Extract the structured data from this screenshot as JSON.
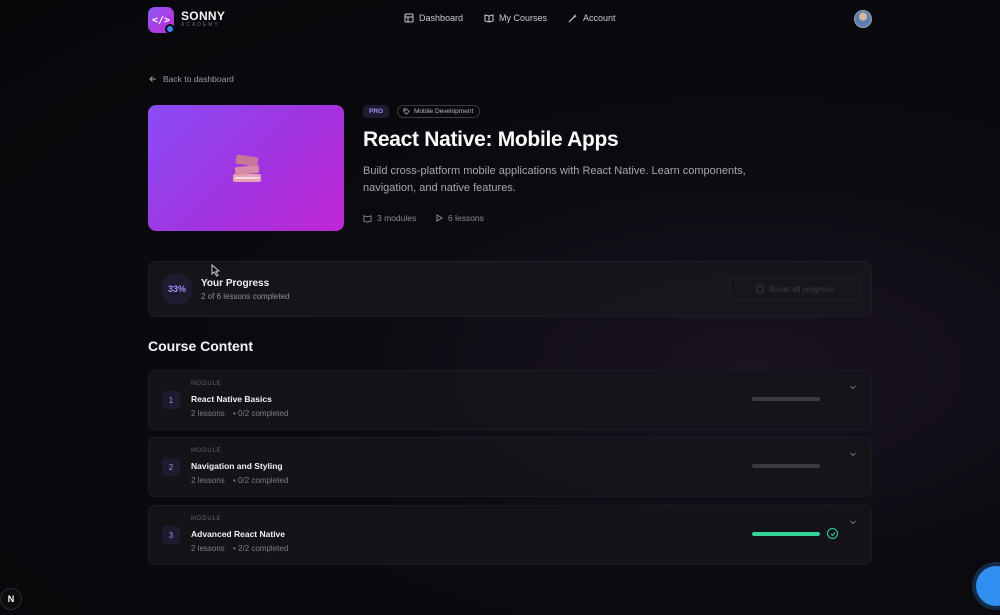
{
  "brand": {
    "name": "SONNY",
    "subtitle": "ACADEMY"
  },
  "nav": {
    "dashboard": "Dashboard",
    "my_courses": "My Courses",
    "account": "Account"
  },
  "back_label": "Back to dashboard",
  "course": {
    "tier": "PRO",
    "category": "Mobile Development",
    "title": "React Native: Mobile Apps",
    "description": "Build cross-platform mobile applications with React Native. Learn components, navigation, and native features.",
    "modules_count": "3 modules",
    "lessons_count": "6 lessons"
  },
  "progress": {
    "percent_label": "33%",
    "title": "Your Progress",
    "subtitle": "2 of 6 lessons completed",
    "reset_label": "Reset all progress"
  },
  "section_title": "Course Content",
  "modules": [
    {
      "number": "1",
      "kicker": "MODULE",
      "title": "React Native Basics",
      "lessons": "2 lessons",
      "completed": "• 0/2 completed",
      "progress": 0
    },
    {
      "number": "2",
      "kicker": "MODULE",
      "title": "Navigation and Styling",
      "lessons": "2 lessons",
      "completed": "• 0/2 completed",
      "progress": 0
    },
    {
      "number": "3",
      "kicker": "MODULE",
      "title": "Advanced React Native",
      "lessons": "2 lessons",
      "completed": "• 2/2 completed",
      "progress": 1
    }
  ],
  "corner_badge": "N",
  "colors": {
    "accent": "#a78bfa",
    "success": "#34d399",
    "brand_gradient_start": "#8b5cf6",
    "brand_gradient_end": "#c026d3"
  }
}
